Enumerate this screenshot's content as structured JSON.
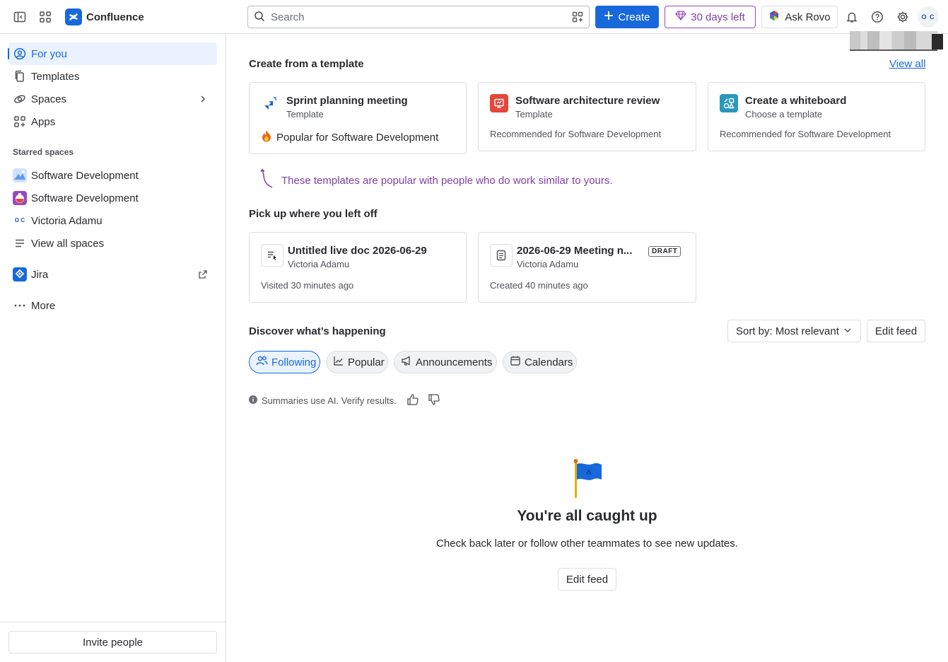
{
  "topbar": {
    "app_name": "Confluence",
    "search_placeholder": "Search",
    "create_label": "Create",
    "trial_label": "30 days left",
    "rovo_label": "Ask Rovo",
    "avatar_initials": "O C"
  },
  "sidebar": {
    "items": [
      {
        "label": "For you",
        "icon": "person-circle-icon"
      },
      {
        "label": "Templates",
        "icon": "templates-icon"
      },
      {
        "label": "Spaces",
        "icon": "spaces-icon"
      },
      {
        "label": "Apps",
        "icon": "apps-icon"
      }
    ],
    "starred_heading": "Starred spaces",
    "starred": [
      {
        "label": "Software Development"
      },
      {
        "label": "Software Development"
      },
      {
        "label": "Victoria Adamu"
      }
    ],
    "view_all_spaces": "View all spaces",
    "jira": "Jira",
    "more": "More",
    "invite": "Invite people"
  },
  "templates": {
    "heading": "Create from a template",
    "view_all": "View all",
    "cards": [
      {
        "title": "Sprint planning meeting",
        "sub": "Template",
        "foot": "Popular for Software Development",
        "icon": "sprint-icon"
      },
      {
        "title": "Software architecture review",
        "sub": "Template",
        "foot": "Recommended for Software Development",
        "icon": "architecture-icon"
      },
      {
        "title": "Create a whiteboard",
        "sub": "Choose a template",
        "foot": "Recommended for Software Development",
        "icon": "whiteboard-icon"
      }
    ],
    "hint": "These templates are popular with people who do work similar to yours."
  },
  "recent": {
    "heading": "Pick up where you left off",
    "cards": [
      {
        "title": "Untitled live doc 2026-06-29",
        "sub": "Victoria Adamu",
        "foot": "Visited 30 minutes ago"
      },
      {
        "title": "2026-06-29 Meeting n...",
        "sub": "Victoria Adamu",
        "foot": "Created 40 minutes ago",
        "badge": "DRAFT"
      }
    ]
  },
  "feed": {
    "heading": "Discover what’s happening",
    "sort_label": "Sort by: Most relevant",
    "edit_feed": "Edit feed",
    "tabs": [
      "Following",
      "Popular",
      "Announcements",
      "Calendars"
    ],
    "ai_note": "Summaries use AI. Verify results.",
    "empty_title": "You're all caught up",
    "empty_sub": "Check back later or follow other teammates to see new updates.",
    "empty_button": "Edit feed"
  },
  "colors": {
    "brand": "#1868db",
    "trial": "#803fa5",
    "border": "#dddee1"
  }
}
